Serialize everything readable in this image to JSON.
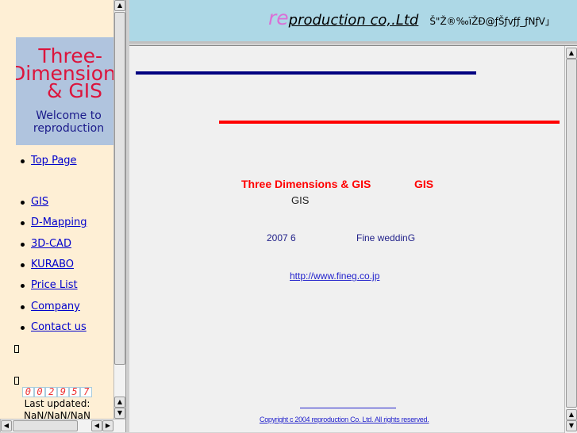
{
  "sidebar": {
    "title": "Three-Dimension & GIS",
    "welcome": "Welcome to reproduction",
    "nav": [
      {
        "label": "Top Page"
      },
      {
        "label": "GIS"
      },
      {
        "label": "D-Mapping"
      },
      {
        "label": "3D-CAD"
      },
      {
        "label": "KURABO"
      },
      {
        "label": "Price List"
      },
      {
        "label": "Company"
      },
      {
        "label": "Contact us"
      }
    ],
    "counter": [
      "0",
      "0",
      "2",
      "9",
      "5",
      "7"
    ],
    "last_updated_label": "Last updated:",
    "last_updated_value": "NaN/NaN/NaN"
  },
  "header": {
    "brand_re": "re",
    "brand_rest": "production co,.Ltd",
    "garbled": "Š\"Ž®‰ïŽÐ@ƒŠƒvƒƒ_ƒNƒV｣"
  },
  "main": {
    "heading_a": "Three Dimensions & GIS",
    "heading_b": "GIS",
    "sub": "GIS",
    "date": "2007 6",
    "partner": "Fine weddinG",
    "link": "http://www.fineg.co.jp",
    "copyright": "Copyright c 2004 reproduction Co. Ltd. All rights reserved.",
    "colors": {
      "blue_line": "#000080",
      "red_line": "#ff0000"
    }
  }
}
